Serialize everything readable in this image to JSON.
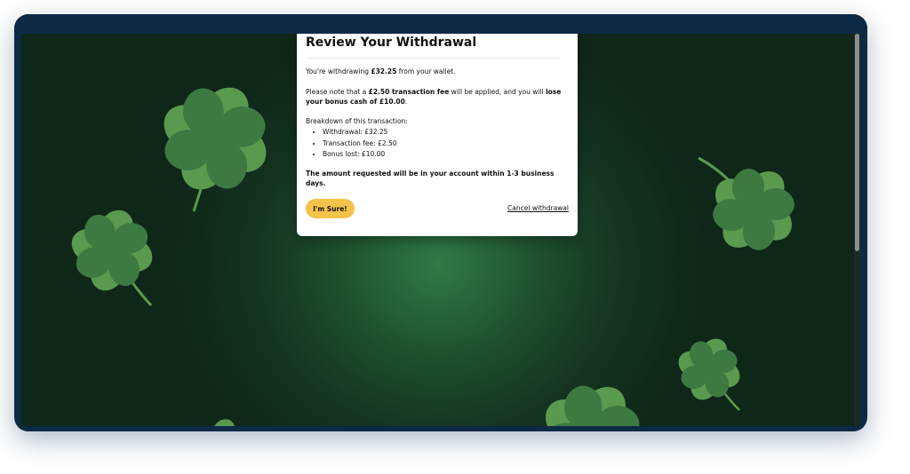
{
  "modal": {
    "title": "Review Your Withdrawal",
    "intro_prefix": "You're withdrawing ",
    "amount": "£32.25",
    "intro_suffix": " from your wallet.",
    "note_prefix": "Please note that a ",
    "fee_text": "£2.50 transaction fee",
    "note_middle": " will be applied, and you will ",
    "lose_text": "lose your bonus cash of £10.00",
    "note_end": ".",
    "breakdown_heading": "Breakdown of this transaction:",
    "breakdown_items": [
      "Withdrawal: £32.25",
      "Transaction fee: £2.50",
      "Bonus lost: £10.00"
    ],
    "final_notice": "The amount requested will be in your account within 1-3 business days.",
    "confirm_label": "I'm Sure!",
    "cancel_label": "Cancel withdrawal"
  },
  "background": {
    "decoration_icon": "four-leaf-clover-icon",
    "colors": {
      "center": "#2f7a46",
      "edge": "#0f2718",
      "leaf_light": "#5a9a4f",
      "leaf_dark": "#3c7a42"
    }
  },
  "colors": {
    "accent_button": "#f5c34a",
    "window_frame": "#0d2a45",
    "modal_bg": "#ffffff"
  }
}
